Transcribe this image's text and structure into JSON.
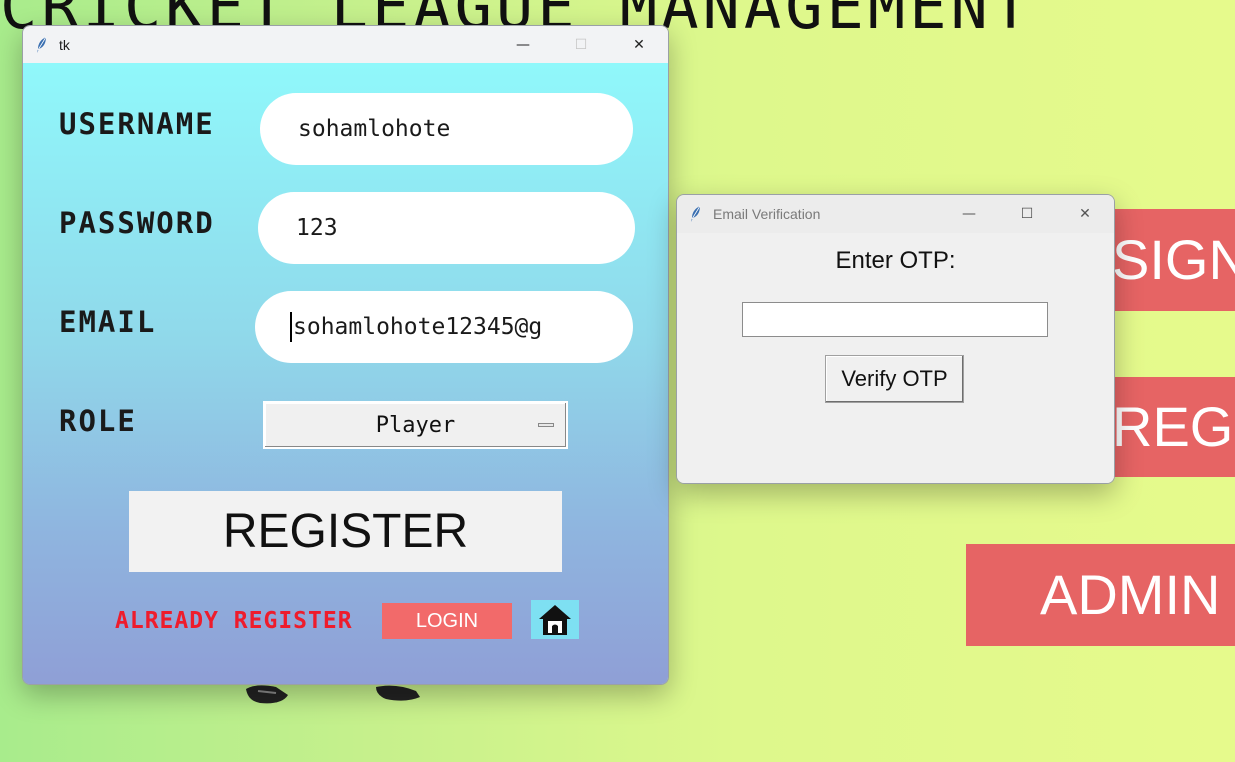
{
  "background_app": {
    "title": "CRICKET LEAGUE MANAGEMENT",
    "buttons": [
      {
        "label": "SIGN"
      },
      {
        "label": "REGIS"
      },
      {
        "label": "ADMIN"
      }
    ],
    "button_color": "#e66464"
  },
  "register_window": {
    "title": "tk",
    "controls": {
      "minimize": "—",
      "maximize": "☐",
      "close": "✕"
    },
    "username_label": "USERNAME",
    "username_value": "sohamlohote",
    "password_label": "PASSWORD",
    "password_value": "123",
    "email_label": "EMAIL",
    "email_value": "sohamlohote12345@g",
    "role_label": "ROLE",
    "role_value": "Player",
    "register_label": "REGISTER",
    "already_text": "ALREADY REGISTER",
    "login_label": "LOGIN",
    "home_icon": "home-icon",
    "colors": {
      "gradient_top": "#90f8fb",
      "gradient_bottom": "#8f9fd6",
      "login_bg": "#f26a6a",
      "already_text": "#ee1c2c"
    }
  },
  "email_window": {
    "title": "Email Verification",
    "controls": {
      "minimize": "—",
      "maximize": "☐",
      "close": "✕"
    },
    "otp_label": "Enter OTP:",
    "otp_value": "",
    "verify_label": "Verify OTP"
  }
}
